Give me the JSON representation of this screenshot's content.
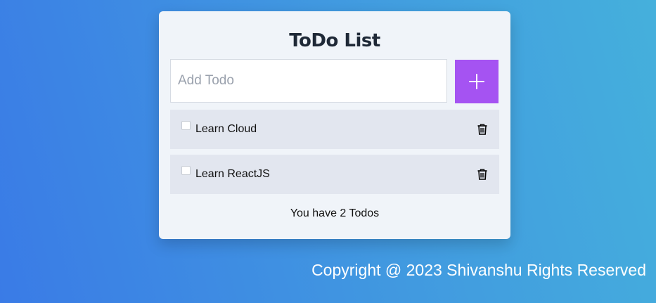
{
  "app": {
    "title": "ToDo List"
  },
  "input": {
    "placeholder": "Add Todo",
    "value": ""
  },
  "add_button": {
    "icon": "plus-icon",
    "color": "#a553f2"
  },
  "todos": [
    {
      "label": "Learn Cloud",
      "checked": false,
      "delete_icon": "trash-icon"
    },
    {
      "label": "Learn ReactJS",
      "checked": false,
      "delete_icon": "trash-icon"
    }
  ],
  "summary": {
    "text": "You have 2 Todos"
  },
  "footer": {
    "copyright": "Copyright @ 2023 Shivanshu Rights Reserved"
  },
  "colors": {
    "background_start": "#3a7be6",
    "background_end": "#45b0dc",
    "card": "#f0f4f9",
    "item": "#e2e6ef"
  }
}
